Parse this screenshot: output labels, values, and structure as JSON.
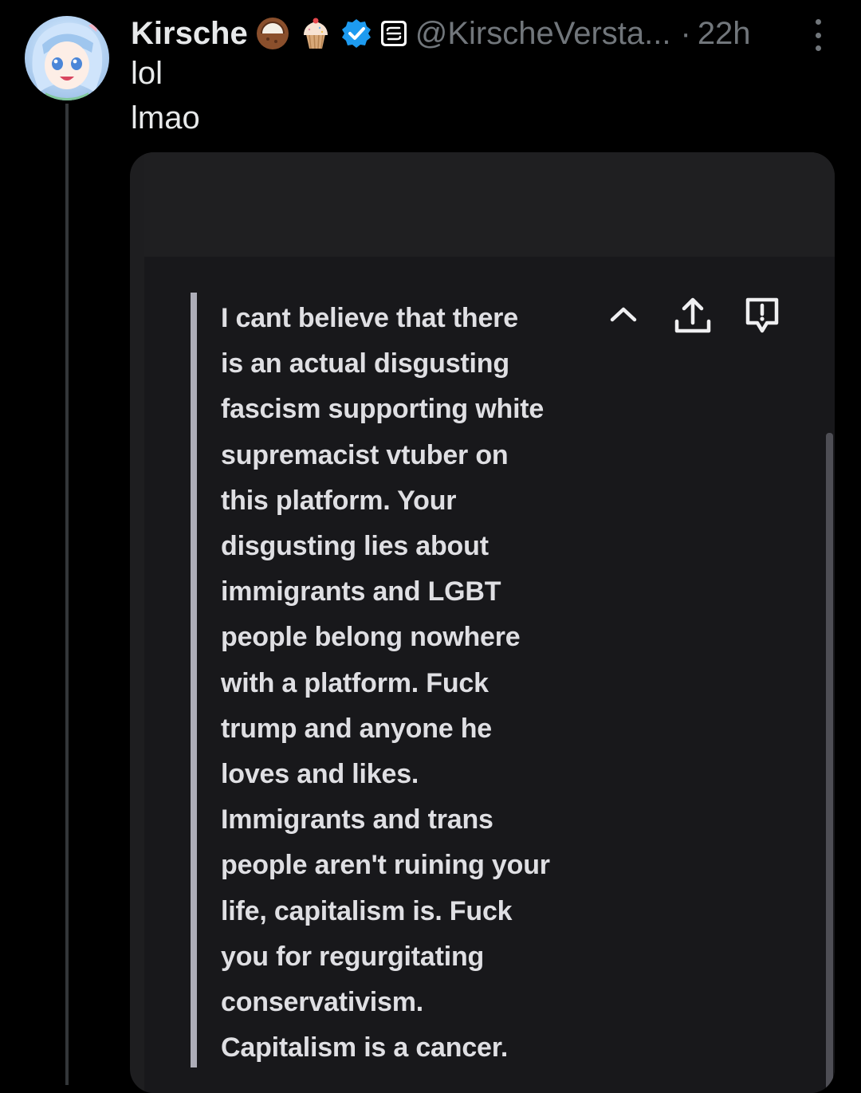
{
  "post": {
    "author_name": "Kirsche",
    "handle": "@KirscheVersta...",
    "separator": "·",
    "timestamp": "22h",
    "text_lines": [
      "lol",
      "lmao"
    ],
    "emojis": [
      "coconut-emoji",
      "cupcake-emoji"
    ],
    "badges": [
      "verified-badge-icon",
      "affiliate-badge-icon"
    ],
    "colors": {
      "background": "#000000",
      "primary_text": "#e7e9ea",
      "secondary_text": "#71767b",
      "verified_blue": "#1d9bf0"
    }
  },
  "attached_image": {
    "message_lines": [
      "I cant believe that there",
      "is an actual disgusting",
      "fascism supporting white",
      "supremacist vtuber on",
      "this platform. Your",
      "disgusting lies about",
      "immigrants and LGBT",
      "people belong nowhere",
      "with a platform. Fuck",
      "trump and anyone he",
      "loves and likes.",
      "Immigrants and trans",
      "people aren't ruining your",
      "life, capitalism is. Fuck",
      "you for regurgitating",
      "conservativism.",
      "Capitalism is a cancer."
    ],
    "controls": [
      "chevron-up-icon",
      "share-upload-icon",
      "report-flag-icon"
    ]
  }
}
